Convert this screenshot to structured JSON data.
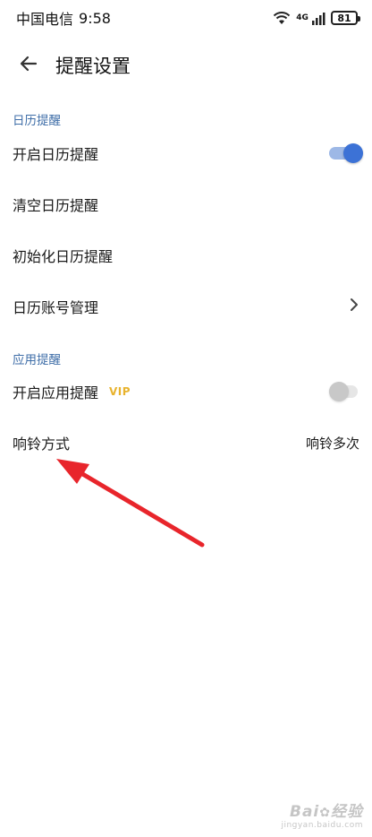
{
  "status_bar": {
    "carrier": "中国电信",
    "time": "9:58",
    "network": "4G",
    "battery": "81",
    "icons": [
      "wifi-icon",
      "signal-icon",
      "battery-icon"
    ]
  },
  "header": {
    "back_icon": "arrow-left-icon",
    "title": "提醒设置"
  },
  "sections": [
    {
      "title": "日历提醒",
      "rows": [
        {
          "label": "开启日历提醒",
          "control": "toggle",
          "state": "on"
        },
        {
          "label": "清空日历提醒"
        },
        {
          "label": "初始化日历提醒"
        },
        {
          "label": "日历账号管理",
          "control": "chevron-right-icon"
        }
      ]
    },
    {
      "title": "应用提醒",
      "rows": [
        {
          "label": "开启应用提醒",
          "badge": "VIP",
          "control": "toggle",
          "state": "off"
        },
        {
          "label": "响铃方式",
          "value": "响铃多次"
        }
      ]
    }
  ],
  "colors": {
    "accent": "#3c72d6",
    "section_title": "#3f6ea8",
    "vip": "#e8b32e",
    "annotation": "#e8252b"
  },
  "watermark": {
    "logo": "Bai du 经验",
    "url": "jingyan.baidu.com"
  }
}
